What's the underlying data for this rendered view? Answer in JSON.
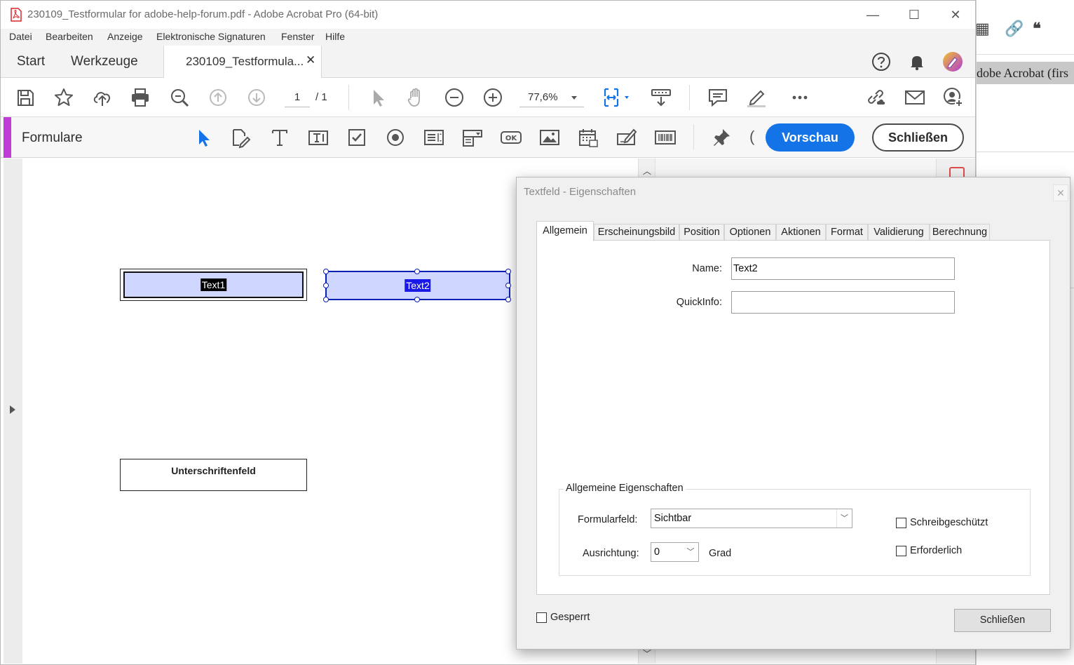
{
  "background_window": {
    "heading_text": "dobe Acrobat (firs"
  },
  "window": {
    "title": "230109_Testformular for adobe-help-forum.pdf - Adobe Acrobat Pro (64-bit)",
    "controls": {
      "minimize": "—",
      "maximize": "☐",
      "close": "✕"
    }
  },
  "menu": {
    "items": [
      "Datei",
      "Bearbeiten",
      "Anzeige",
      "Elektronische Signaturen",
      "Fenster",
      "Hilfe"
    ]
  },
  "tabs": {
    "start": "Start",
    "tools": "Werkzeuge",
    "document": "230109_Testformula...",
    "document_close": "✕"
  },
  "toolbar": {
    "page_current": "1",
    "page_total": "/ 1",
    "zoom": "77,6%"
  },
  "formbar": {
    "label": "Formulare",
    "partial_glyph": "(",
    "preview_button": "Vorschau",
    "close_button": "Schließen",
    "accent_color": "#c13bd6",
    "preview_color": "#1473e6"
  },
  "document": {
    "fields": {
      "text1": "Text1",
      "text2": "Text2",
      "signature": "Unterschriftenfeld"
    }
  },
  "dialog": {
    "title": "Textfeld - Eigenschaften",
    "close_glyph": "✕",
    "tabs": [
      "Allgemein",
      "Erscheinungsbild",
      "Position",
      "Optionen",
      "Aktionen",
      "Format",
      "Validierung",
      "Berechnung"
    ],
    "active_tab": "Allgemein",
    "name_label": "Name:",
    "name_value": "Text2",
    "tooltip_label": "QuickInfo:",
    "tooltip_value": "",
    "group_title": "Allgemeine Eigenschaften",
    "form_field_label": "Formularfeld:",
    "form_field_value": "Sichtbar",
    "orientation_label": "Ausrichtung:",
    "orientation_value": "0",
    "orientation_unit": "Grad",
    "readonly_label": "Schreibgeschützt",
    "readonly_checked": false,
    "required_label": "Erforderlich",
    "required_checked": false,
    "locked_label": "Gesperrt",
    "locked_checked": false,
    "close_button": "Schließen"
  }
}
